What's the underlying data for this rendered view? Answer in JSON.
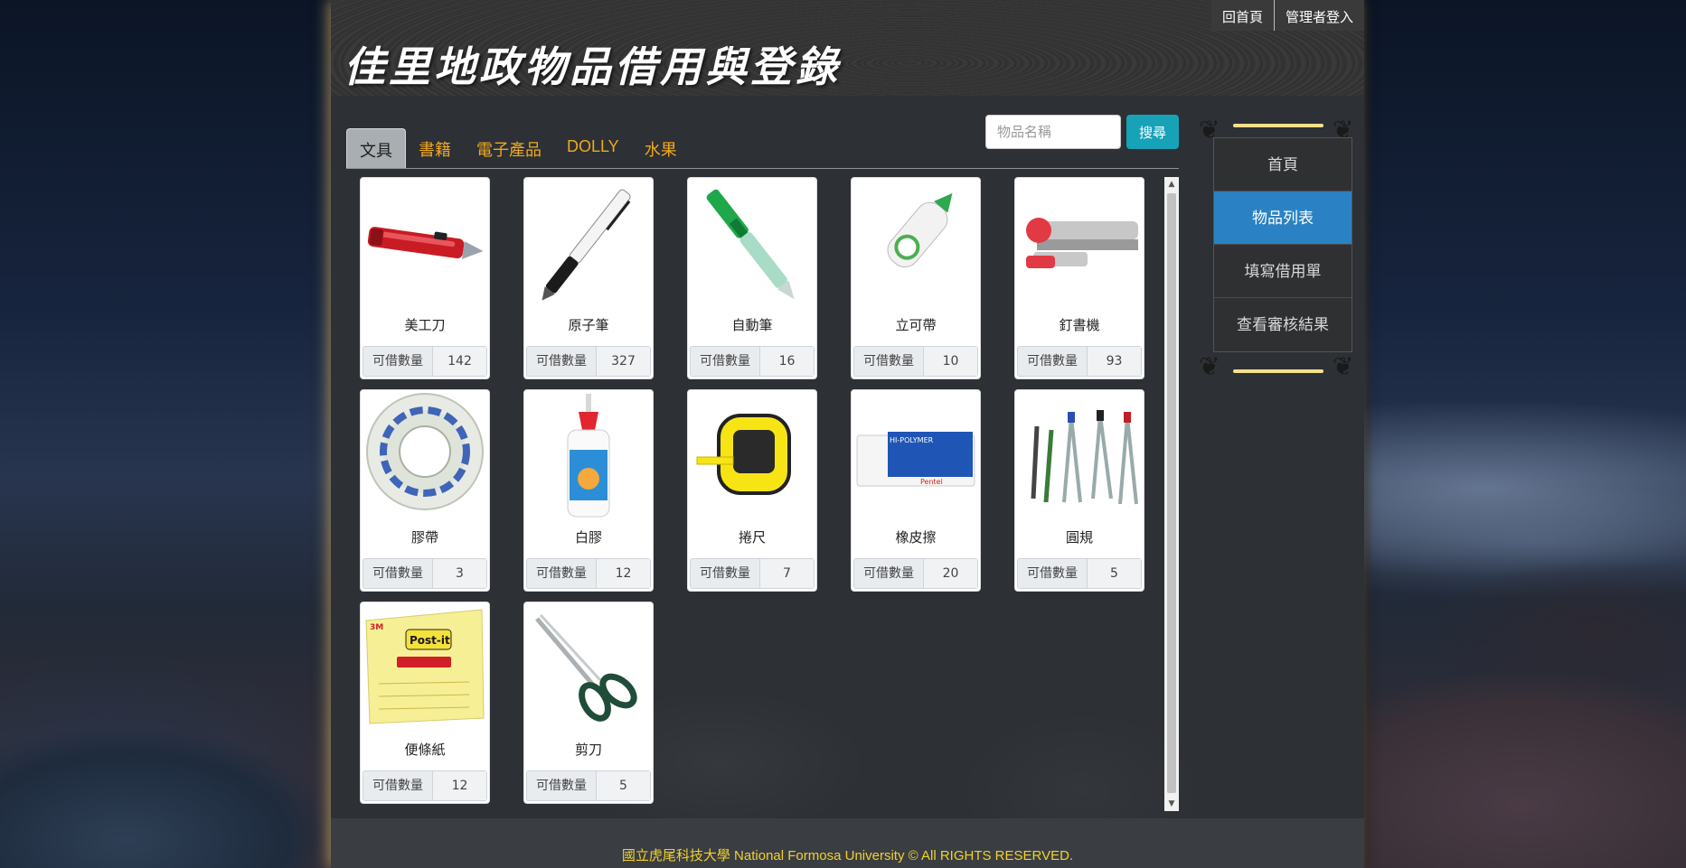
{
  "header": {
    "site_title": "佳里地政物品借用與登錄",
    "home_link": "回首頁",
    "admin_login": "管理者登入"
  },
  "tabs": [
    {
      "label": "文具",
      "active": true
    },
    {
      "label": "書籍",
      "active": false
    },
    {
      "label": "電子產品",
      "active": false
    },
    {
      "label": "DOLLY",
      "active": false
    },
    {
      "label": "水果",
      "active": false
    }
  ],
  "search": {
    "placeholder": "物品名稱",
    "button_label": "搜尋"
  },
  "items": [
    {
      "name": "美工刀",
      "qty_label": "可借數量",
      "qty": "142",
      "icon": "utility-knife-icon"
    },
    {
      "name": "原子筆",
      "qty_label": "可借數量",
      "qty": "327",
      "icon": "ballpoint-pen-icon"
    },
    {
      "name": "自動筆",
      "qty_label": "可借數量",
      "qty": "16",
      "icon": "mechanical-pencil-icon"
    },
    {
      "name": "立可帶",
      "qty_label": "可借數量",
      "qty": "10",
      "icon": "correction-tape-icon"
    },
    {
      "name": "釘書機",
      "qty_label": "可借數量",
      "qty": "93",
      "icon": "stapler-icon"
    },
    {
      "name": "膠帶",
      "qty_label": "可借數量",
      "qty": "3",
      "icon": "tape-roll-icon"
    },
    {
      "name": "白膠",
      "qty_label": "可借數量",
      "qty": "12",
      "icon": "glue-bottle-icon"
    },
    {
      "name": "捲尺",
      "qty_label": "可借數量",
      "qty": "7",
      "icon": "tape-measure-icon"
    },
    {
      "name": "橡皮擦",
      "qty_label": "可借數量",
      "qty": "20",
      "icon": "eraser-icon"
    },
    {
      "name": "圓規",
      "qty_label": "可借數量",
      "qty": "5",
      "icon": "compass-set-icon"
    },
    {
      "name": "便條紙",
      "qty_label": "可借數量",
      "qty": "12",
      "icon": "sticky-notes-icon"
    },
    {
      "name": "剪刀",
      "qty_label": "可借數量",
      "qty": "5",
      "icon": "scissors-icon"
    }
  ],
  "item_image_text": {
    "eraser_brand": "HI-POLYMER",
    "eraser_maker": "Pentel",
    "notes_brand": "Post-it",
    "notes_maker": "3M"
  },
  "side_nav": [
    {
      "label": "首頁",
      "active": false
    },
    {
      "label": "物品列表",
      "active": true
    },
    {
      "label": "填寫借用單",
      "active": false
    },
    {
      "label": "查看審核結果",
      "active": false
    }
  ],
  "footer": {
    "copyright": "國立虎尾科技大學 National Formosa University © All RIGHTS RESERVED."
  },
  "colors": {
    "tab_text": "#f0a91e",
    "active_nav": "#2a82c4",
    "search_button": "#17a2b8",
    "footer_text": "#f2d22c"
  }
}
